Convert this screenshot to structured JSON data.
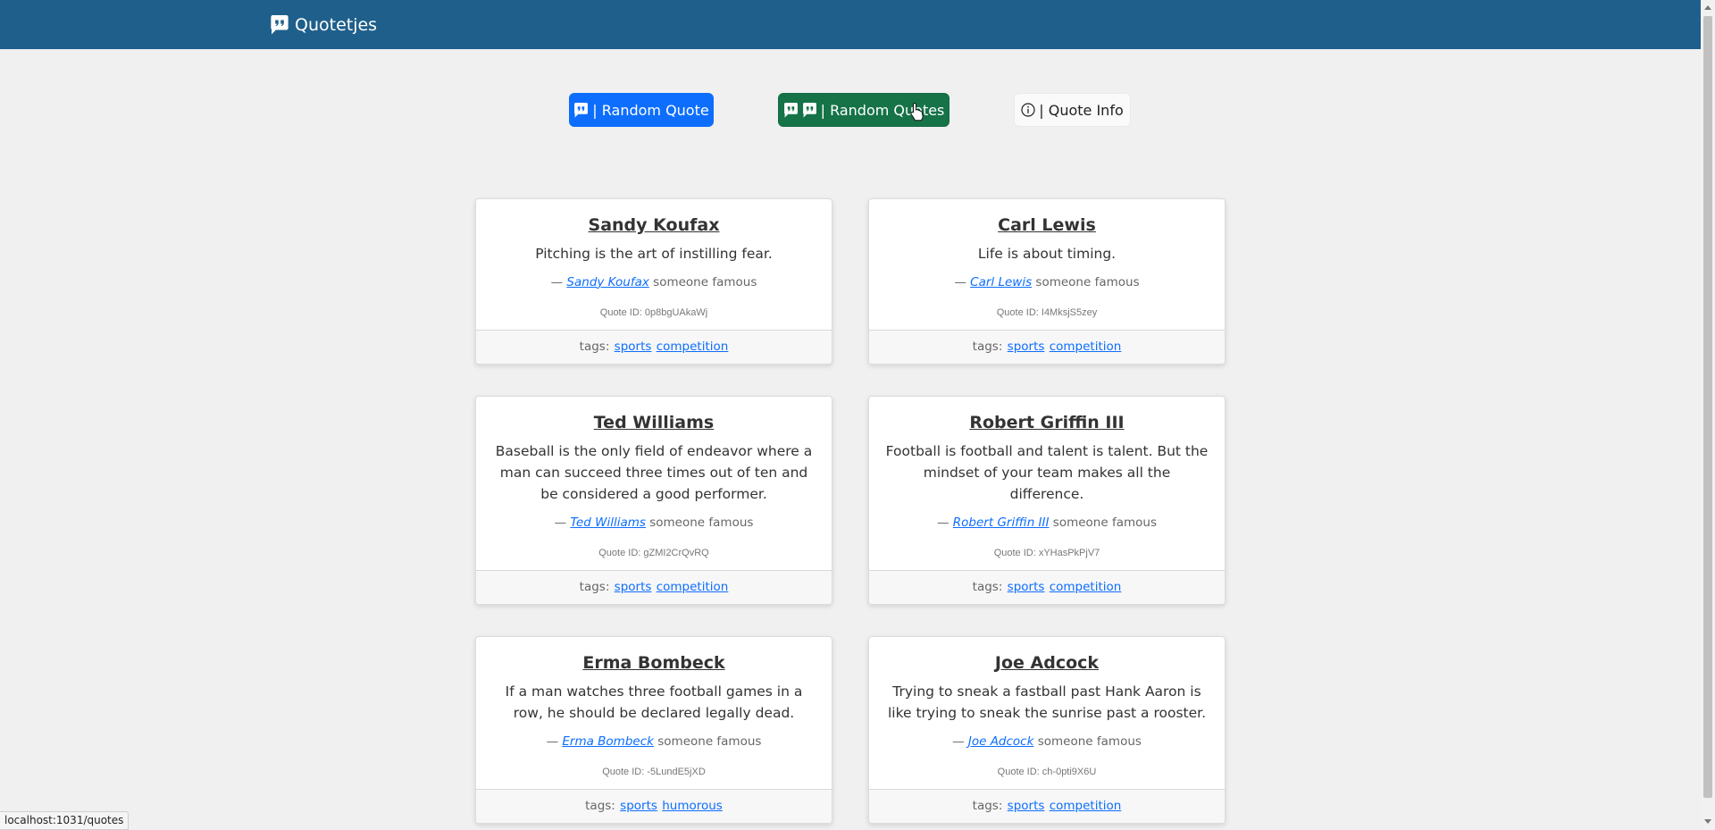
{
  "app": {
    "brand": "Quotetjes",
    "brand_icon": "quote-bubble-icon"
  },
  "toolbar": {
    "random_quote_label": "| Random Quote",
    "random_quotes_label": "| Random Quotes",
    "quote_info_label": "| Quote Info"
  },
  "colors": {
    "navbar": "#1f5f8b",
    "primary": "#0d6efd",
    "success": "#157347",
    "link": "#0d6efd"
  },
  "quotes": [
    {
      "author": "Sandy Koufax",
      "text": "Pitching is the art of instilling fear.",
      "dash": "—",
      "suffix": "someone famous",
      "id_label": "Quote ID: 0p8bgUAkaWj",
      "tags_label": "tags:",
      "tags": [
        "sports",
        "competition"
      ]
    },
    {
      "author": "Carl Lewis",
      "text": "Life is about timing.",
      "dash": "—",
      "suffix": "someone famous",
      "id_label": "Quote ID: I4MksjS5zey",
      "tags_label": "tags:",
      "tags": [
        "sports",
        "competition"
      ]
    },
    {
      "author": "Ted Williams",
      "text": "Baseball is the only field of endeavor where a man can succeed three times out of ten and be considered a good performer.",
      "dash": "—",
      "suffix": "someone famous",
      "id_label": "Quote ID: gZMI2CrQvRQ",
      "tags_label": "tags:",
      "tags": [
        "sports",
        "competition"
      ]
    },
    {
      "author": "Robert Griffin III",
      "text": "Football is football and talent is talent. But the mindset of your team makes all the difference.",
      "dash": "—",
      "suffix": "someone famous",
      "id_label": "Quote ID: xYHasPkPjV7",
      "tags_label": "tags:",
      "tags": [
        "sports",
        "competition"
      ]
    },
    {
      "author": "Erma Bombeck",
      "text": "If a man watches three football games in a row, he should be declared legally dead.",
      "dash": "—",
      "suffix": "someone famous",
      "id_label": "Quote ID: -5LundE5jXD",
      "tags_label": "tags:",
      "tags": [
        "sports",
        "humorous"
      ]
    },
    {
      "author": "Joe Adcock",
      "text": "Trying to sneak a fastball past Hank Aaron is like trying to sneak the sunrise past a rooster.",
      "dash": "—",
      "suffix": "someone famous",
      "id_label": "Quote ID: ch-0pti9X6U",
      "tags_label": "tags:",
      "tags": [
        "sports",
        "competition"
      ]
    }
  ],
  "status_bar": {
    "url": "localhost:1031/quotes"
  }
}
